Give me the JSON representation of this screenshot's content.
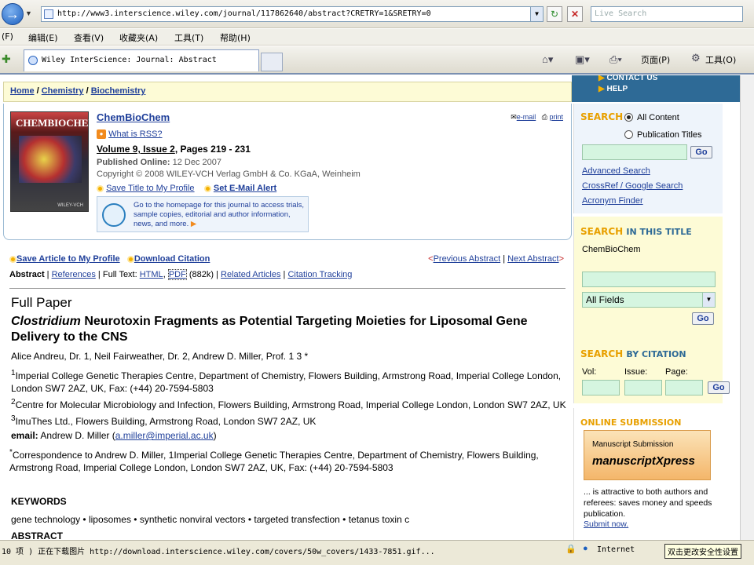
{
  "browser": {
    "url": "http://www3.interscience.wiley.com/journal/117862640/abstract?CRETRY=1&SRETRY=0",
    "live_search_placeholder": "Live Search",
    "tab_title": "Wiley InterScience: Journal: Abstract",
    "menu": [
      "(F)",
      "编辑(E)",
      "查看(V)",
      "收藏夹(A)",
      "工具(T)",
      "帮助(H)"
    ],
    "toolbar_page": "页面(P)",
    "toolbar_tools": "工具(O)",
    "status_text": "10 项 ) 正在下载图片 http://download.interscience.wiley.com/covers/50w_covers/1433-7851.gif...",
    "status_zone": "Internet",
    "status_hint": "双击更改安全性设置"
  },
  "topnav": {
    "contact": "CONTACT US",
    "help": "HELP"
  },
  "breadcrumb": {
    "home": "Home",
    "chemistry": "Chemistry",
    "biochem": "Biochemistry"
  },
  "journal": {
    "cover_title": "CHEMBIOCHEM",
    "cover_foot": "WILEY-VCH",
    "name": "ChemBioChem",
    "rss": "What is RSS?",
    "volume": "Volume 9, Issue 2",
    "pages": ", Pages 219 - 231",
    "published_label": "Published Online:",
    "published_date": "12 Dec 2007",
    "copyright": "Copyright © 2008 WILEY-VCH Verlag GmbH & Co. KGaA, Weinheim",
    "save_title": "Save Title to My Profile",
    "set_alert": "Set E-Mail Alert",
    "promo": "Go to the homepage for this journal to access trials, sample copies, editorial and author information, news, and more.",
    "email": "e-mail",
    "print": "print"
  },
  "article_bar": {
    "save_article": "Save Article to My Profile",
    "download": "Download Citation",
    "prev": "Previous Abstract",
    "next": "Next Abstract"
  },
  "tabs": {
    "abstract": "Abstract",
    "references": "References",
    "fulltext_label": "Full Text:",
    "html": "HTML",
    "pdf": "PDF",
    "pdf_size": "(882k)",
    "related": "Related Articles",
    "tracking": "Citation Tracking"
  },
  "article": {
    "full_paper": "Full Paper",
    "title_italic": "Clostridium",
    "title_rest": " Neurotoxin Fragments as Potential Targeting Moieties for Liposomal Gene Delivery to the CNS",
    "authors": "Alice Andreu, Dr. 1, Neil Fairweather, Dr. 2, Andrew D. Miller, Prof. 1 3 *",
    "affil1": "Imperial College Genetic Therapies Centre, Department of Chemistry, Flowers Building, Armstrong Road, Imperial College London, London SW7 2AZ, UK, Fax: (+44) 20-7594-5803",
    "affil2": "Centre for Molecular Microbiology and Infection, Flowers Building, Armstrong Road, Imperial College London, London SW7 2AZ, UK",
    "affil3": "ImuThes Ltd., Flowers Building, Armstrong Road, London SW7 2AZ, UK",
    "email_label": "email:",
    "email_name": "Andrew D. Miller (",
    "email_addr": "a.miller@imperial.ac.uk",
    "email_end": ")",
    "correspondence": "Correspondence to Andrew D. Miller, 1Imperial College Genetic Therapies Centre, Department of Chemistry, Flowers Building, Armstrong Road, Imperial College London, London SW7 2AZ, UK, Fax: (+44) 20-7594-5803",
    "keywords_h": "KEYWORDS",
    "keywords": "gene technology • liposomes • synthetic nonviral vectors • targeted transfection • tetanus toxin c",
    "abstract_h": "ABSTRACT"
  },
  "sidebar": {
    "search_h": "SEARCH",
    "all_content": "All Content",
    "pub_titles": "Publication Titles",
    "go": "Go",
    "advanced": "Advanced Search",
    "crossref": "CrossRef / Google Search",
    "acronym": "Acronym Finder",
    "in_title_h": "SEARCH",
    "in_title_sub": "IN THIS TITLE",
    "in_title_name": "ChemBioChem",
    "field_select": "All Fields",
    "by_citation_h": "SEARCH",
    "by_citation_sub": "BY CITATION",
    "vol": "Vol:",
    "issue": "Issue:",
    "page": "Page:",
    "online_sub_h": "ONLINE SUBMISSION",
    "ms_label": "Manuscript Submission",
    "ms_brand": "manuscriptXpress",
    "ms_desc": "... is attractive to both authors and referees: saves money and speeds publication.",
    "submit": "Submit now."
  }
}
